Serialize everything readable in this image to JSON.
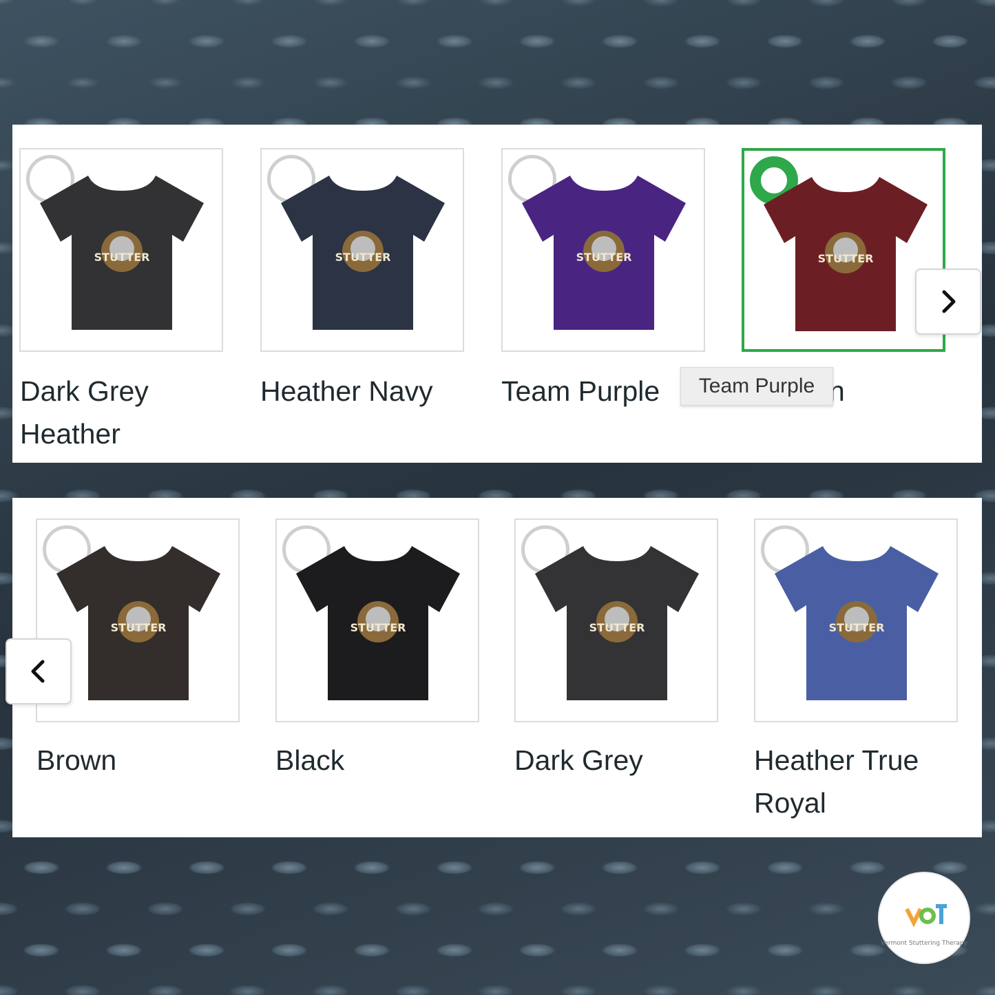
{
  "row1": {
    "items": [
      {
        "label": "Dark Grey Heather",
        "color": "#323234",
        "selected": false
      },
      {
        "label": "Heather Navy",
        "color": "#2b3345",
        "selected": false
      },
      {
        "label": "Team Purple",
        "color": "#4a2481",
        "selected": false
      },
      {
        "label": "Maroon",
        "color": "#6b1f24",
        "selected": true
      }
    ],
    "visible_label_fragment": "n",
    "tooltip": "Team Purple",
    "next_icon": "chevron-right-icon"
  },
  "row2": {
    "items": [
      {
        "label": "Brown",
        "color": "#332e2b",
        "selected": false
      },
      {
        "label": "Black",
        "color": "#1c1c1e",
        "selected": false
      },
      {
        "label": "Dark Grey",
        "color": "#333335",
        "selected": false
      },
      {
        "label": "Heather True Royal",
        "color": "#4a5fa3",
        "selected": false
      }
    ],
    "prev_icon": "chevron-left-icon"
  },
  "design_text": "STUTTER",
  "logo": {
    "mark": "VST",
    "text": "Vermont Stuttering Therapy"
  },
  "colors": {
    "selected_accent": "#2ea84a"
  }
}
